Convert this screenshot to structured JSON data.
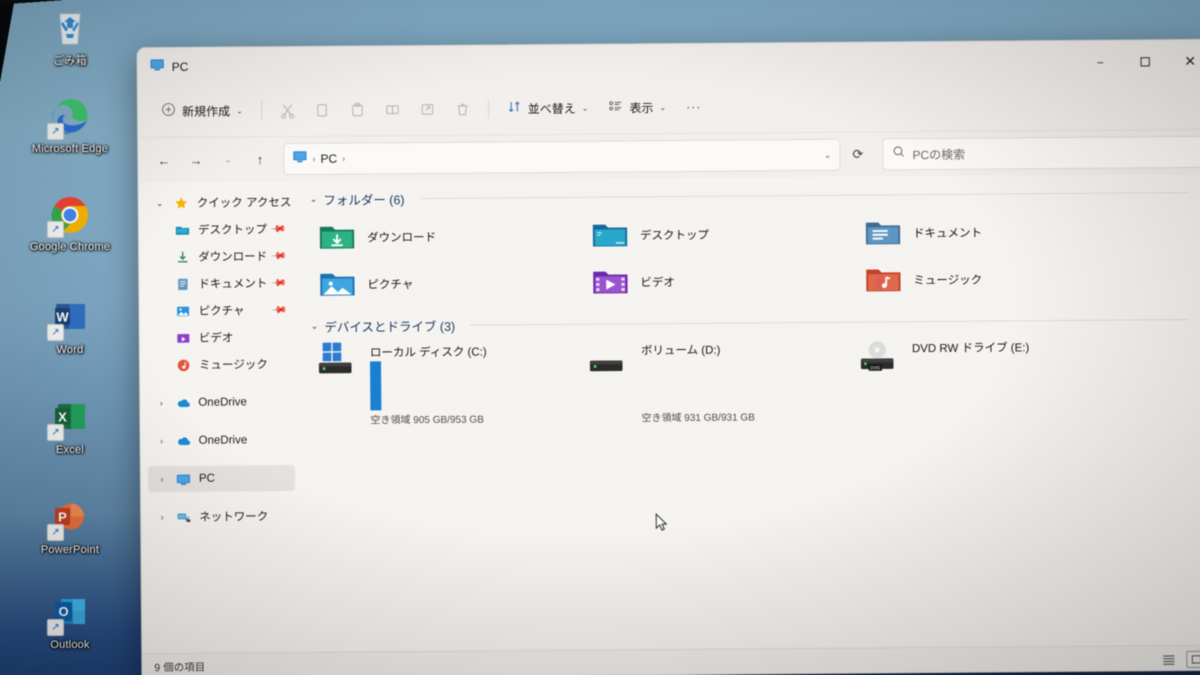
{
  "desktop": {
    "background_color": "#7ea7c2",
    "icons": [
      {
        "label": "ごみ箱",
        "icon": "recycle-bin-icon",
        "shortcut": false
      },
      {
        "label": "Microsoft Edge",
        "icon": "microsoft-edge-icon",
        "shortcut": true
      },
      {
        "label": "Google Chrome",
        "icon": "google-chrome-icon",
        "shortcut": true
      },
      {
        "label": "Word",
        "icon": "microsoft-word-icon",
        "shortcut": true
      },
      {
        "label": "Excel",
        "icon": "microsoft-excel-icon",
        "shortcut": true
      },
      {
        "label": "PowerPoint",
        "icon": "microsoft-powerpoint-icon",
        "shortcut": true
      },
      {
        "label": "Outlook",
        "icon": "microsoft-outlook-icon",
        "shortcut": true
      }
    ]
  },
  "window": {
    "title": "PC",
    "title_icon": "this-pc-icon",
    "controls": {
      "minimize": "−",
      "maximize": "▢",
      "close": "✕"
    }
  },
  "toolbar": {
    "new_label": "新規作成",
    "new_chevron": "⌄",
    "cut_label": "切り取り",
    "copy_label": "コピー",
    "paste_label": "貼り付け",
    "rename_label": "名前の変更",
    "share_label": "共有",
    "delete_label": "削除",
    "sort_label": "並べ替え",
    "sort_chevron": "⌄",
    "view_label": "表示",
    "view_chevron": "⌄",
    "more_label": "···"
  },
  "navbar": {
    "back": "←",
    "forward": "→",
    "recent_chevron": "⌄",
    "up": "↑",
    "breadcrumb": [
      {
        "label": "",
        "icon": "this-pc-icon"
      },
      {
        "label": "PC",
        "icon": ""
      }
    ],
    "breadcrumb_separator": "›",
    "address_chevron": "⌄",
    "refresh": "⟳",
    "search_placeholder": "PCの検索",
    "search_value": "",
    "search_icon": "search-icon"
  },
  "sidebar": {
    "items": [
      {
        "label": "クイック アクセス",
        "icon": "star-icon",
        "twisty": "⌄",
        "indent": false,
        "pinned": false,
        "selected": false
      },
      {
        "label": "デスクトップ",
        "icon": "desktop-folder-icon",
        "twisty": "",
        "indent": true,
        "pinned": true,
        "selected": false
      },
      {
        "label": "ダウンロード",
        "icon": "downloads-folder-icon",
        "twisty": "",
        "indent": true,
        "pinned": true,
        "selected": false
      },
      {
        "label": "ドキュメント",
        "icon": "documents-folder-icon",
        "twisty": "",
        "indent": true,
        "pinned": true,
        "selected": false
      },
      {
        "label": "ピクチャ",
        "icon": "pictures-folder-icon",
        "twisty": "",
        "indent": true,
        "pinned": true,
        "selected": false
      },
      {
        "label": "ビデオ",
        "icon": "videos-folder-icon",
        "twisty": "",
        "indent": true,
        "pinned": false,
        "selected": false
      },
      {
        "label": "ミュージック",
        "icon": "music-folder-icon",
        "twisty": "",
        "indent": true,
        "pinned": false,
        "selected": false
      },
      {
        "label": "OneDrive",
        "icon": "onedrive-icon",
        "twisty": "›",
        "indent": false,
        "pinned": false,
        "selected": false
      },
      {
        "label": "OneDrive",
        "icon": "onedrive-icon",
        "twisty": "›",
        "indent": false,
        "pinned": false,
        "selected": false
      },
      {
        "label": "PC",
        "icon": "this-pc-icon",
        "twisty": "›",
        "indent": false,
        "pinned": false,
        "selected": true
      },
      {
        "label": "ネットワーク",
        "icon": "network-icon",
        "twisty": "›",
        "indent": false,
        "pinned": false,
        "selected": false
      }
    ]
  },
  "content": {
    "folders_group": {
      "title": "フォルダー (6)",
      "twisty": "⌄"
    },
    "folders": [
      {
        "name": "ダウンロード",
        "icon": "downloads-folder-icon",
        "color_a": "#1f9e6e",
        "color_b": "#2bbd86"
      },
      {
        "name": "デスクトップ",
        "icon": "desktop-folder-icon",
        "color_a": "#1b7bb5",
        "color_b": "#29b0cf"
      },
      {
        "name": "ドキュメント",
        "icon": "documents-folder-icon",
        "color_a": "#3d6e95",
        "color_b": "#5e97c2"
      },
      {
        "name": "ピクチャ",
        "icon": "pictures-folder-icon",
        "color_a": "#1e7fc4",
        "color_b": "#4bb4e8"
      },
      {
        "name": "ビデオ",
        "icon": "videos-folder-icon",
        "color_a": "#7a2fb5",
        "color_b": "#a55fd6"
      },
      {
        "name": "ミュージック",
        "icon": "music-folder-icon",
        "color_a": "#d2452f",
        "color_b": "#e8734e"
      }
    ],
    "drives_group": {
      "title": "デバイスとドライブ (3)",
      "twisty": "⌄"
    },
    "drives": [
      {
        "name": "ローカル ディスク (C:)",
        "icon": "windows-drive-icon",
        "free_text": "空き領域 905 GB/953 GB",
        "free_gb": 905,
        "total_gb": 953,
        "used_percent": 5,
        "bar_color": "#1a7fd4",
        "has_bar": true
      },
      {
        "name": "ボリューム (D:)",
        "icon": "hard-drive-icon",
        "free_text": "空き領域 931 GB/931 GB",
        "free_gb": 931,
        "total_gb": 931,
        "used_percent": 0,
        "bar_color": "#1a7fd4",
        "has_bar": true
      },
      {
        "name": "DVD RW ドライブ (E:)",
        "icon": "dvd-drive-icon",
        "free_text": "",
        "free_gb": 0,
        "total_gb": 0,
        "used_percent": 0,
        "bar_color": "#1a7fd4",
        "has_bar": false
      }
    ]
  },
  "statusbar": {
    "item_count_text": "9 個の項目",
    "details_view_icon": "details-view-icon",
    "large_icons_view_icon": "large-icons-view-icon"
  },
  "colors": {
    "accent": "#1a7fd4",
    "window_bg": "#f3f1ee",
    "selection": "#e5e2de",
    "group_title": "#17365d"
  }
}
